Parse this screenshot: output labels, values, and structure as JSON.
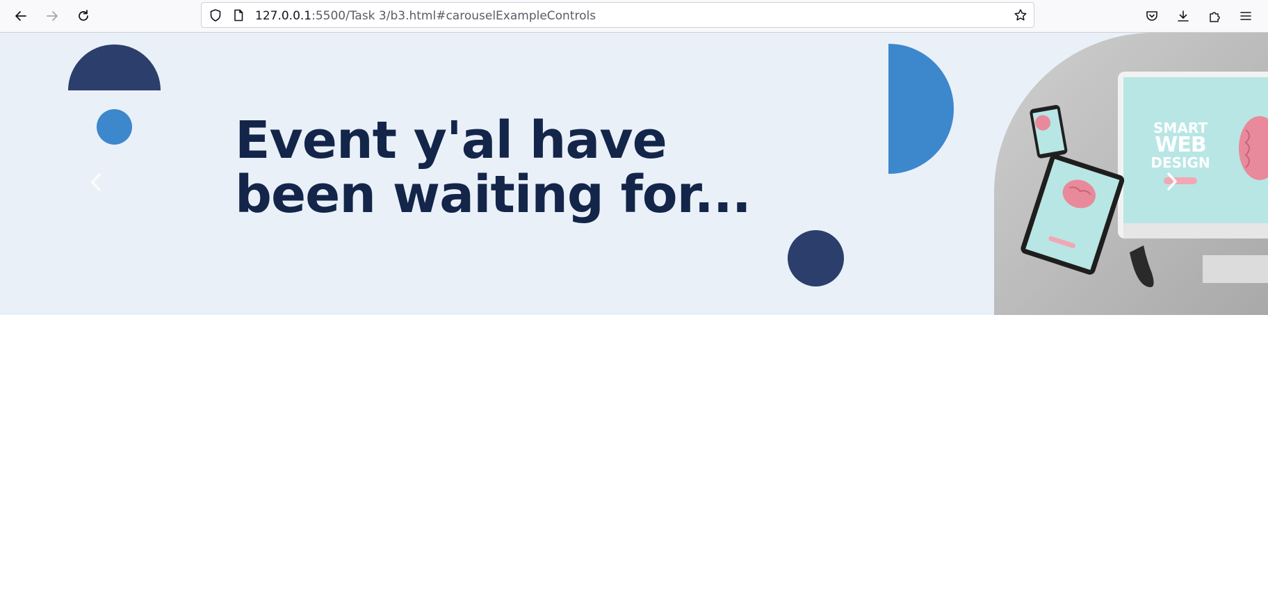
{
  "browser": {
    "url_host": "127.0.0.1",
    "url_rest": ":5500/Task 3/b3.html#carouselExampleControls",
    "icons": {
      "back": "arrow-left-icon",
      "forward": "arrow-right-icon",
      "reload": "reload-icon",
      "tracking": "shield-icon",
      "page": "page-icon",
      "bookmark": "star-icon",
      "pocket": "pocket-icon",
      "downloads": "download-icon",
      "extensions": "puzzle-icon",
      "menu": "hamburger-menu-icon"
    }
  },
  "carousel": {
    "headline_line1": "Event y'al have",
    "headline_line2": "been waiting for...",
    "image": {
      "line1": "SMART",
      "line2": "WEB",
      "line3": "DESIGN"
    },
    "colors": {
      "background": "#e9f0f8",
      "navy": "#2c3e6b",
      "blue": "#3d87cc",
      "headline": "#14254a"
    }
  }
}
